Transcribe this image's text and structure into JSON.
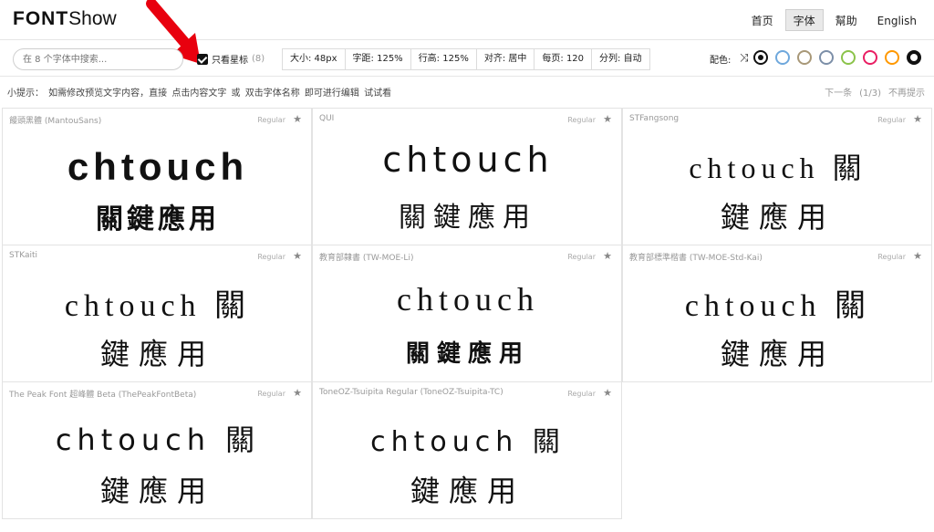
{
  "header": {
    "logo_bold": "FONT",
    "logo_light": "Show",
    "nav": [
      "首页",
      "字体",
      "幫助",
      "English"
    ],
    "active_nav": "字体"
  },
  "toolbar": {
    "search_placeholder": "在 8 个字体中搜索...",
    "fav_label": "只看星标",
    "fav_count": "(8)",
    "fav_checked": true,
    "size": "大小: 48px",
    "letter_spacing": "字距: 125%",
    "line_height": "行高: 125%",
    "align": "对齐: 居中",
    "per_page": "每页: 120",
    "columns": "分列: 自动",
    "color_label": "配色:",
    "shuffle_icon": "shuffle-icon",
    "swatch_colors": [
      "#111111",
      "#6fa8dc",
      "#a89878",
      "#7c8fa8",
      "#8bc34a",
      "#e91e63",
      "#ff9800",
      "#111111"
    ],
    "selected_swatch": 0
  },
  "tips": {
    "text": "小提示：  如需修改预览文字内容，直接 点击内容文字 或 双击字体名称 即可进行编辑  试试看",
    "next": "下一条",
    "page": "(1/3)",
    "hide": "不再提示"
  },
  "cards": [
    {
      "name": "饅頭黑體 (MantouSans)",
      "style": "Regular",
      "latin": "chtouch",
      "cjk": "關鍵應用",
      "layout": "split"
    },
    {
      "name": "QUI",
      "style": "Regular",
      "latin": "chtouch",
      "cjk": "關鍵應用",
      "layout": "split"
    },
    {
      "name": "STFangsong",
      "style": "Regular",
      "latin": "chtouch  關",
      "cjk": "鍵應用",
      "layout": "wrap"
    },
    {
      "name": "STKaiti",
      "style": "Regular",
      "latin": "chtouch  關",
      "cjk": "鍵應用",
      "layout": "wrap"
    },
    {
      "name": "教育部隸書 (TW-MOE-Li)",
      "style": "Regular",
      "latin": "chtouch",
      "cjk": "關鍵應用",
      "layout": "split"
    },
    {
      "name": "教育部標準楷書 (TW-MOE-Std-Kai)",
      "style": "Regular",
      "latin": "chtouch  關",
      "cjk": "鍵應用",
      "layout": "wrap"
    },
    {
      "name": "The Peak Font 超峰體 Beta (ThePeakFontBeta)",
      "style": "Regular",
      "latin": "chtouch  關",
      "cjk": "鍵應用",
      "layout": "wrap"
    },
    {
      "name": "ToneOZ-Tsuipita Regular (ToneOZ-Tsuipita-TC)",
      "style": "Regular",
      "latin": "chtouch  關",
      "cjk": "鍵應用",
      "layout": "wrap"
    }
  ]
}
